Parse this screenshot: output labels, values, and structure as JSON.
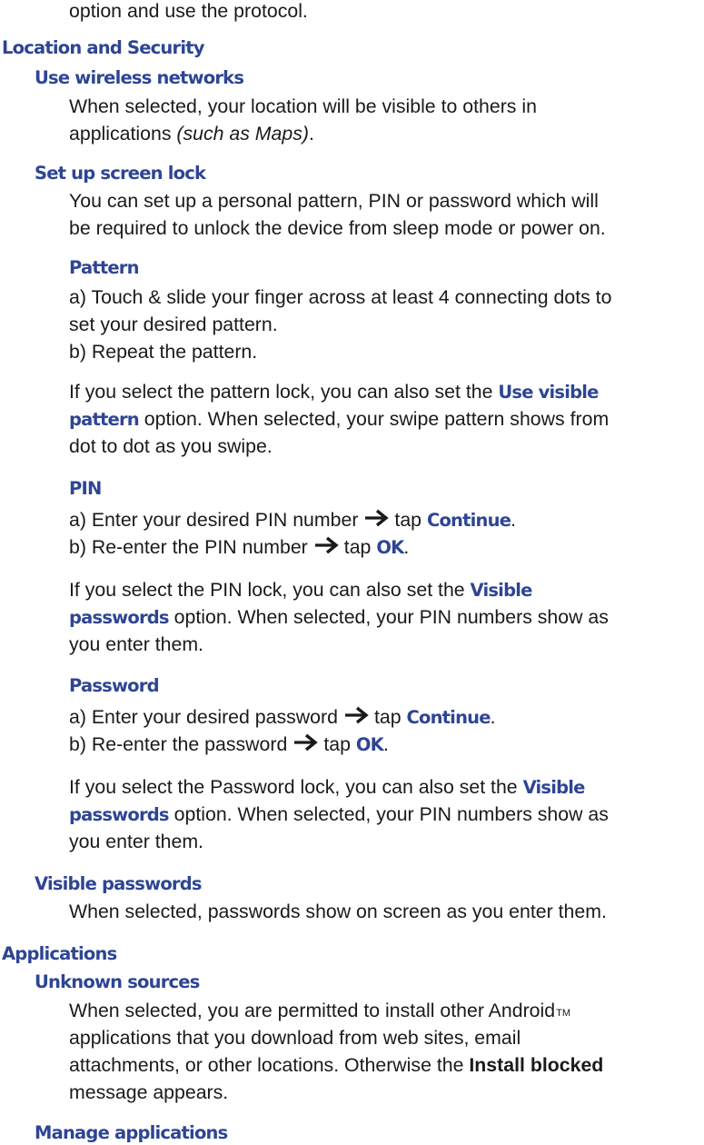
{
  "colors": {
    "heading": "#2e4594",
    "text": "#1a1a1a"
  },
  "intro": {
    "line": "option and use the protocol."
  },
  "location_security": {
    "title": "Location and Security",
    "wireless": {
      "title": "Use wireless networks",
      "line1": "When selected, your location will be visible to others in",
      "line2_prefix": "applications ",
      "line2_italic": "(such as Maps)",
      "line2_suffix": "."
    },
    "screen_lock": {
      "title": "Set up screen lock",
      "line1": "You can set up a personal pattern, PIN or password which will",
      "line2": "be required to unlock the device from sleep mode or power on.",
      "pattern": {
        "title": "Pattern",
        "step_a1": "a) Touch & slide your finger across at least 4 connecting dots to",
        "step_a2": "set your desired pattern.",
        "step_b": "b) Repeat the pattern.",
        "note1_prefix": "If you select the pattern lock, you can also set the ",
        "note1_kw": "Use visible",
        "note2_kw": "pattern",
        "note2_suffix": " option. When selected, your swipe pattern shows from",
        "note3": "dot to dot as you swipe."
      },
      "pin": {
        "title": "PIN",
        "step_a_prefix": "a) Enter your desired PIN number",
        "step_a_tap": "tap ",
        "step_a_kw": "Continue",
        "step_a_suffix": ".",
        "step_b_prefix": "b) Re-enter the PIN number",
        "step_b_tap": "tap ",
        "step_b_kw": "OK",
        "step_b_suffix": ".",
        "note1_prefix": "If you select the PIN lock, you can also set the ",
        "note1_kw": "Visible",
        "note2_kw": "passwords",
        "note2_suffix": " option. When selected, your PIN numbers show as",
        "note3": "you enter them."
      },
      "password": {
        "title": "Password",
        "step_a_prefix": "a) Enter your desired password",
        "step_a_tap": "tap ",
        "step_a_kw": "Continue",
        "step_a_suffix": ".",
        "step_b_prefix": "b) Re-enter the password",
        "step_b_tap": "tap ",
        "step_b_kw": "OK",
        "step_b_suffix": ".",
        "note1_prefix": "If you select the Password lock, you can also set the ",
        "note1_kw": "Visible",
        "note2_kw": "passwords",
        "note2_suffix": " option. When selected, your PIN numbers show as",
        "note3": "you enter them."
      }
    },
    "visible_passwords": {
      "title": "Visible passwords",
      "line1": "When selected, passwords show on screen as you enter them."
    }
  },
  "applications": {
    "title": "Applications",
    "unknown_sources": {
      "title": "Unknown sources",
      "line1": "When selected, you are permitted to install other Android",
      "line1_tm": "TM",
      "line2": "applications that you download from web sites, email",
      "line3_prefix": "attachments, or other locations. Otherwise the ",
      "line3_bold": "Install blocked",
      "line4": "message appears."
    },
    "manage": {
      "title": "Manage applications"
    }
  },
  "icons": {
    "step_arrow": "right-arrow-icon"
  }
}
